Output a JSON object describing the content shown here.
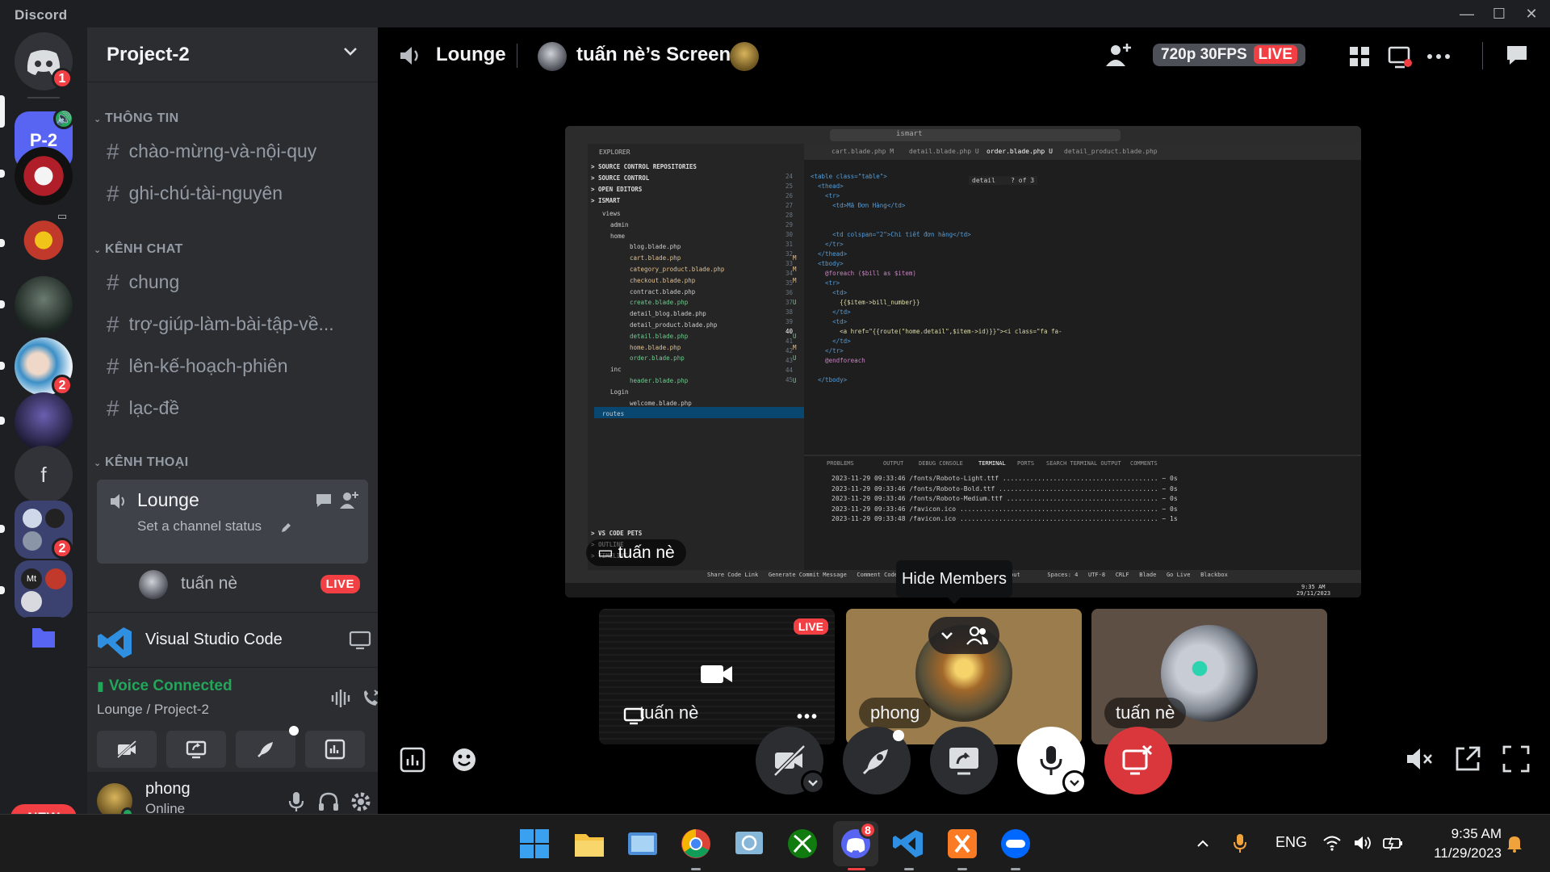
{
  "window": {
    "app_name": "Discord"
  },
  "rail": {
    "home_badge": "1",
    "server_p2_label": "P-2",
    "server_s8_badge": "2",
    "server_s10_letter": "f",
    "server_s11_badge": "2",
    "server_s12_text": "Mt",
    "new_label": "NEW"
  },
  "sidebar": {
    "server_name": "Project-2",
    "categories": [
      {
        "name": "THÔNG TIN",
        "channels": [
          "chào-mừng-và-nội-quy",
          "ghi-chú-tài-nguyên"
        ]
      },
      {
        "name": "KÊNH CHAT",
        "channels": [
          "chung",
          "trợ-giúp-làm-bài-tập-về...",
          "lên-kế-hoạch-phiên",
          "lạc-đề"
        ]
      },
      {
        "name": "KÊNH THOẠI",
        "channels": []
      }
    ],
    "voice_channel": {
      "name": "Lounge",
      "status_placeholder": "Set a channel status"
    },
    "voice_member": {
      "name": "tuấn nè",
      "badge": "LIVE"
    },
    "activity": {
      "name": "Visual Studio Code"
    },
    "voice_status": {
      "title": "Voice Connected",
      "subtitle": "Lounge / Project-2"
    },
    "user": {
      "name": "phong",
      "status": "Online"
    }
  },
  "main": {
    "channel_name": "Lounge",
    "screen_title": "tuấn nè’s Screen",
    "quality": "720p 30FPS",
    "live": "LIVE",
    "stream_owner": "tuấn nè",
    "tooltip": "Hide Members",
    "tiles": [
      {
        "name": "tuấn nè",
        "badge": "LIVE",
        "more": "•••"
      },
      {
        "name": "phong"
      },
      {
        "name": "tuấn nè"
      }
    ]
  },
  "vscode": {
    "explorer_title": "EXPLORER",
    "sections": [
      "SOURCE CONTROL REPOSITORIES",
      "SOURCE CONTROL",
      "OPEN EDITORS",
      "ISMART"
    ],
    "tree": [
      {
        "label": "views",
        "mark": ""
      },
      {
        "label": "admin",
        "mark": ""
      },
      {
        "label": "home",
        "mark": ""
      },
      {
        "label": "blog.blade.php",
        "mark": ""
      },
      {
        "label": "cart.blade.php",
        "mark": "M"
      },
      {
        "label": "category_product.blade.php",
        "mark": "M"
      },
      {
        "label": "checkout.blade.php",
        "mark": "M"
      },
      {
        "label": "contract.blade.php",
        "mark": ""
      },
      {
        "label": "create.blade.php",
        "mark": "U"
      },
      {
        "label": "detail_blog.blade.php",
        "mark": ""
      },
      {
        "label": "detail_product.blade.php",
        "mark": ""
      },
      {
        "label": "detail.blade.php",
        "mark": "U"
      },
      {
        "label": "home.blade.php",
        "mark": "M"
      },
      {
        "label": "order.blade.php",
        "mark": "U"
      },
      {
        "label": "inc",
        "mark": ""
      },
      {
        "label": "header.blade.php",
        "mark": "U"
      },
      {
        "label": "Login",
        "mark": ""
      },
      {
        "label": "welcome.blade.php",
        "mark": ""
      },
      {
        "label": "routes",
        "mark": ""
      }
    ],
    "bottom_sections": [
      "VS CODE PETS",
      "OUTLINE",
      "TIMELINE"
    ],
    "tabs": [
      "cart.blade.php M",
      "detail.blade.php U",
      "order.blade.php U",
      "detail_product.blade.php"
    ],
    "search": "ismart",
    "find_text": "detail",
    "find_count": "? of 3",
    "line_numbers": [
      "24",
      "25",
      "26",
      "27",
      "28",
      "29",
      "30",
      "31",
      "32",
      "33",
      "34",
      "35",
      "36",
      "37",
      "38",
      "39",
      "40",
      "41",
      "42",
      "43",
      "44",
      "45"
    ],
    "code": [
      "<table class=\"table\">",
      "  <thead>",
      "    <tr>",
      "      <td>Mã Đơn Hàng</td>",
      "",
      "",
      "      <td colspan=\"2\">Chi tiết đơn hàng</td>",
      "    </tr>",
      "  </thead>",
      "  <tbody>",
      "    @foreach ($bill as $item)",
      "    <tr>",
      "      <td>",
      "        {{$item->bill_number}}",
      "      </td>",
      "      <td>",
      "        <a href=\"{{route(\"home.detail\",$item->id)}}\"><i class=\"fa fa-",
      "      </td>",
      "    </tr>",
      "    @endforeach",
      "",
      "  </tbody>"
    ],
    "panel_tabs": [
      "PROBLEMS",
      "OUTPUT",
      "DEBUG CONSOLE",
      "TERMINAL",
      "PORTS",
      "SEARCH TERMINAL OUTPUT",
      "COMMENTS"
    ],
    "terminal": [
      "2023-11-29 09:33:46 /fonts/Roboto-Light.ttf ........................................ ~ 0s",
      "2023-11-29 09:33:46 /fonts/Roboto-Bold.ttf ......................................... ~ 0s",
      "2023-11-29 09:33:46 /fonts/Roboto-Medium.ttf ....................................... ~ 0s",
      "2023-11-29 09:33:46 /favicon.ico ................................................... ~ 0s",
      "2023-11-29 09:33:48 /favicon.ico ................................................... ~ 1s"
    ],
    "statusbar": "Share Code Link   Generate Commit Message   Comment Code   Blackbox   Search Terminal Output        Spaces: 4   UTF-8   CRLF   Blade   Go Live   Blackbox",
    "clock": "9:35 AM",
    "date": "29/11/2023"
  },
  "taskbar": {
    "discord_badge": "8",
    "lang": "ENG",
    "time": "9:35 AM",
    "date": "11/29/2023"
  },
  "colors": {
    "accent": "#5865f2",
    "live_red": "#f23f43",
    "connected_green": "#23a55a"
  }
}
